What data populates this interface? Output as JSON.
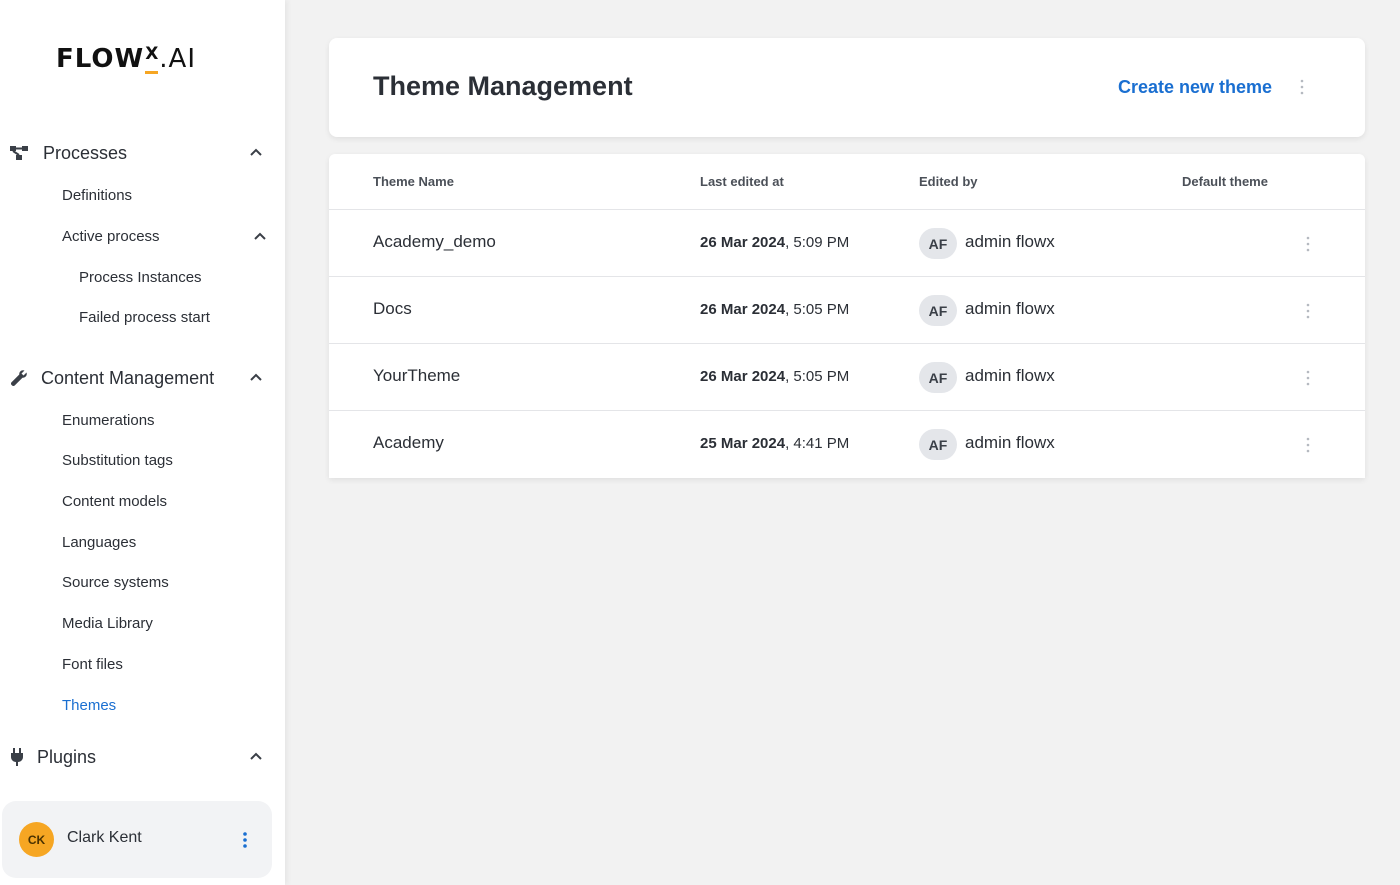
{
  "app": {
    "logo_text": "FLOWX.AI"
  },
  "sidebar": {
    "sections": [
      {
        "label": "Processes",
        "icon": "processes-icon"
      },
      {
        "label": "Content Management",
        "icon": "wrench-icon"
      },
      {
        "label": "Plugins",
        "icon": "plug-icon"
      }
    ],
    "processes_items": [
      {
        "label": "Definitions"
      },
      {
        "label": "Active process"
      }
    ],
    "active_process_items": [
      {
        "label": "Process Instances"
      },
      {
        "label": "Failed process start"
      }
    ],
    "content_items": [
      {
        "label": "Enumerations"
      },
      {
        "label": "Substitution tags"
      },
      {
        "label": "Content models"
      },
      {
        "label": "Languages"
      },
      {
        "label": "Source systems"
      },
      {
        "label": "Media Library"
      },
      {
        "label": "Font files"
      },
      {
        "label": "Themes",
        "active": true
      }
    ],
    "user": {
      "initials": "CK",
      "name": "Clark Kent"
    }
  },
  "header": {
    "title": "Theme Management",
    "create_label": "Create new theme"
  },
  "table": {
    "columns": [
      "Theme Name",
      "Last edited at",
      "Edited by",
      "Default theme"
    ],
    "rows": [
      {
        "name": "Academy_demo",
        "date": "26 Mar 2024",
        "time": ", 5:09 PM",
        "editor_initials": "AF",
        "editor": "admin flowx"
      },
      {
        "name": "Docs",
        "date": "26 Mar 2024",
        "time": ", 5:05 PM",
        "editor_initials": "AF",
        "editor": "admin flowx"
      },
      {
        "name": "YourTheme",
        "date": "26 Mar 2024",
        "time": ", 5:05 PM",
        "editor_initials": "AF",
        "editor": "admin flowx"
      },
      {
        "name": "Academy",
        "date": "25 Mar 2024",
        "time": ", 4:41 PM",
        "editor_initials": "AF",
        "editor": "admin flowx"
      }
    ]
  },
  "colors": {
    "accent": "#1a6fd1",
    "brand_orange": "#f6a623",
    "background": "#f2f2f2"
  }
}
